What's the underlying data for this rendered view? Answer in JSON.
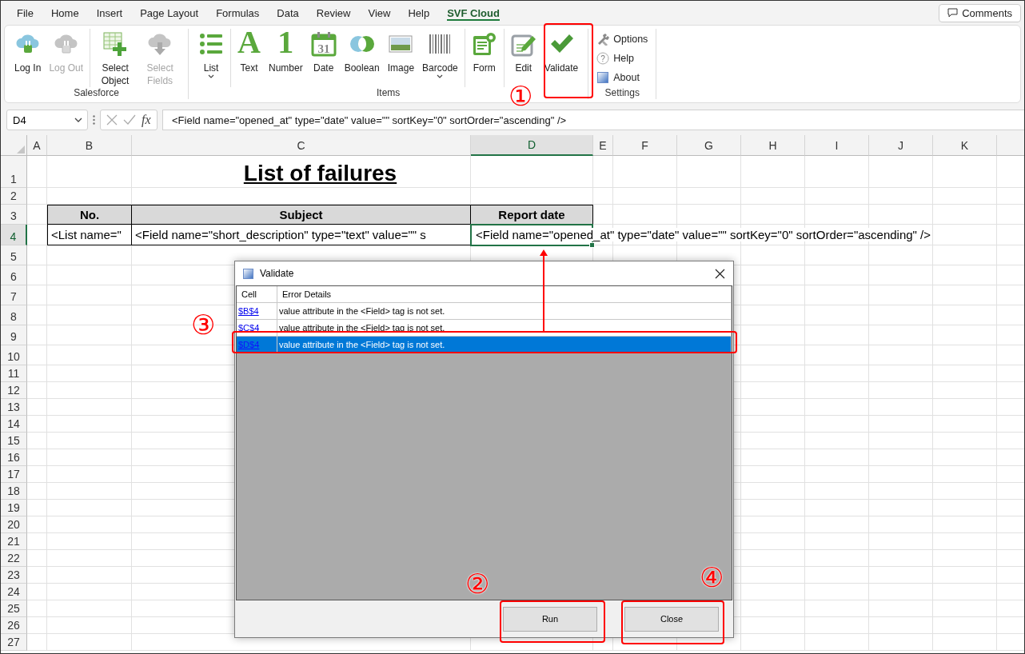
{
  "menu_tabs": [
    {
      "label": "File",
      "selected": false
    },
    {
      "label": "Home",
      "selected": false
    },
    {
      "label": "Insert",
      "selected": false
    },
    {
      "label": "Page Layout",
      "selected": false
    },
    {
      "label": "Formulas",
      "selected": false
    },
    {
      "label": "Data",
      "selected": false
    },
    {
      "label": "Review",
      "selected": false
    },
    {
      "label": "View",
      "selected": false
    },
    {
      "label": "Help",
      "selected": false
    },
    {
      "label": "SVF Cloud",
      "selected": true
    }
  ],
  "comments_button": {
    "label": "Comments"
  },
  "ribbon_groups": [
    {
      "label": "Salesforce",
      "kind": "large",
      "sections": [
        [
          {
            "kind": "log-in",
            "label": "Log In",
            "disabled": false
          },
          {
            "kind": "log-out",
            "label": "Log Out",
            "disabled": true
          }
        ],
        [
          {
            "kind": "select-object",
            "label": "Select Object",
            "disabled": false
          },
          {
            "kind": "select-fields",
            "label": "Select Fields",
            "disabled": true
          }
        ]
      ]
    },
    {
      "label": "Items",
      "kind": "large",
      "sections": [
        [
          {
            "kind": "list",
            "label": "List",
            "disabled": false,
            "dropdown": true
          }
        ],
        [
          {
            "kind": "text",
            "label": "Text",
            "disabled": false,
            "glyph": "A"
          },
          {
            "kind": "number",
            "label": "Number",
            "disabled": false,
            "glyph": "1"
          },
          {
            "kind": "date",
            "label": "Date",
            "disabled": false,
            "glyph": "31"
          },
          {
            "kind": "boolean",
            "label": "Boolean",
            "disabled": false
          },
          {
            "kind": "image",
            "label": "Image",
            "disabled": false
          },
          {
            "kind": "barcode",
            "label": "Barcode",
            "disabled": false,
            "dropdown": true
          }
        ],
        [
          {
            "kind": "form",
            "label": "Form",
            "disabled": false
          }
        ],
        [
          {
            "kind": "edit",
            "label": "Edit",
            "disabled": false
          },
          {
            "kind": "validate",
            "label": "Validate",
            "disabled": false
          }
        ]
      ]
    },
    {
      "label": "Settings",
      "kind": "small",
      "sections": [
        [
          {
            "kind": "options",
            "label": "Options",
            "disabled": false
          },
          {
            "kind": "help",
            "label": "Help",
            "disabled": false,
            "glyph": "?"
          },
          {
            "kind": "about",
            "label": "About",
            "disabled": false
          }
        ]
      ]
    }
  ],
  "formula_bar": {
    "name_box": "D4",
    "function_glyph": "fx",
    "formula": "<Field name=\"opened_at\" type=\"date\" value=\"\" sortKey=\"0\" sortOrder=\"ascending\" />"
  },
  "sheet": {
    "columns": [
      {
        "label": "A",
        "selected": false
      },
      {
        "label": "B",
        "selected": false
      },
      {
        "label": "C",
        "selected": false
      },
      {
        "label": "D",
        "selected": true
      },
      {
        "label": "E",
        "selected": false
      },
      {
        "label": "F",
        "selected": false
      },
      {
        "label": "G",
        "selected": false
      },
      {
        "label": "H",
        "selected": false
      },
      {
        "label": "I",
        "selected": false
      },
      {
        "label": "J",
        "selected": false
      },
      {
        "label": "K",
        "selected": false
      }
    ],
    "rows": [
      {
        "label": "1",
        "selected": false
      },
      {
        "label": "2",
        "selected": false
      },
      {
        "label": "3",
        "selected": false
      },
      {
        "label": "4",
        "selected": true
      },
      {
        "label": "5",
        "selected": false
      },
      {
        "label": "6",
        "selected": false
      },
      {
        "label": "7",
        "selected": false
      },
      {
        "label": "8",
        "selected": false
      },
      {
        "label": "9",
        "selected": false
      },
      {
        "label": "10",
        "selected": false
      },
      {
        "label": "11",
        "selected": false
      },
      {
        "label": "12",
        "selected": false
      },
      {
        "label": "13",
        "selected": false
      },
      {
        "label": "14",
        "selected": false
      },
      {
        "label": "15",
        "selected": false
      },
      {
        "label": "16",
        "selected": false
      },
      {
        "label": "17",
        "selected": false
      },
      {
        "label": "18",
        "selected": false
      },
      {
        "label": "19",
        "selected": false
      },
      {
        "label": "20",
        "selected": false
      },
      {
        "label": "21",
        "selected": false
      },
      {
        "label": "22",
        "selected": false
      },
      {
        "label": "23",
        "selected": false
      },
      {
        "label": "24",
        "selected": false
      },
      {
        "label": "25",
        "selected": false
      },
      {
        "label": "26",
        "selected": false
      },
      {
        "label": "27",
        "selected": false
      }
    ],
    "title": "List of failures",
    "table": {
      "columns": [
        "No.",
        "Subject",
        "Report date"
      ],
      "rows": [
        [
          "<List name=\"",
          "<Field name=\"short_description\" type=\"text\" value=\"\" s",
          "<Field name=\"opened_at\" type=\"date\" value=\"\" sortKey=\"0\" sortOrder=\"ascending\" />"
        ]
      ]
    }
  },
  "dialog": {
    "title": "Validate",
    "columns": [
      "Cell",
      "Error Details"
    ],
    "rows": [
      {
        "cell": "$B$4",
        "details": "value attribute in the <Field> tag is not set.",
        "selected": false
      },
      {
        "cell": "$C$4",
        "details": "value attribute in the <Field> tag is not set.",
        "selected": false
      },
      {
        "cell": "$D$4",
        "details": "value attribute in the <Field> tag is not set.",
        "selected": true
      }
    ],
    "buttons": [
      "Run",
      "Close"
    ]
  },
  "annotations": [
    {
      "label": "①"
    },
    {
      "label": "②"
    },
    {
      "label": "③"
    },
    {
      "label": "④"
    }
  ]
}
